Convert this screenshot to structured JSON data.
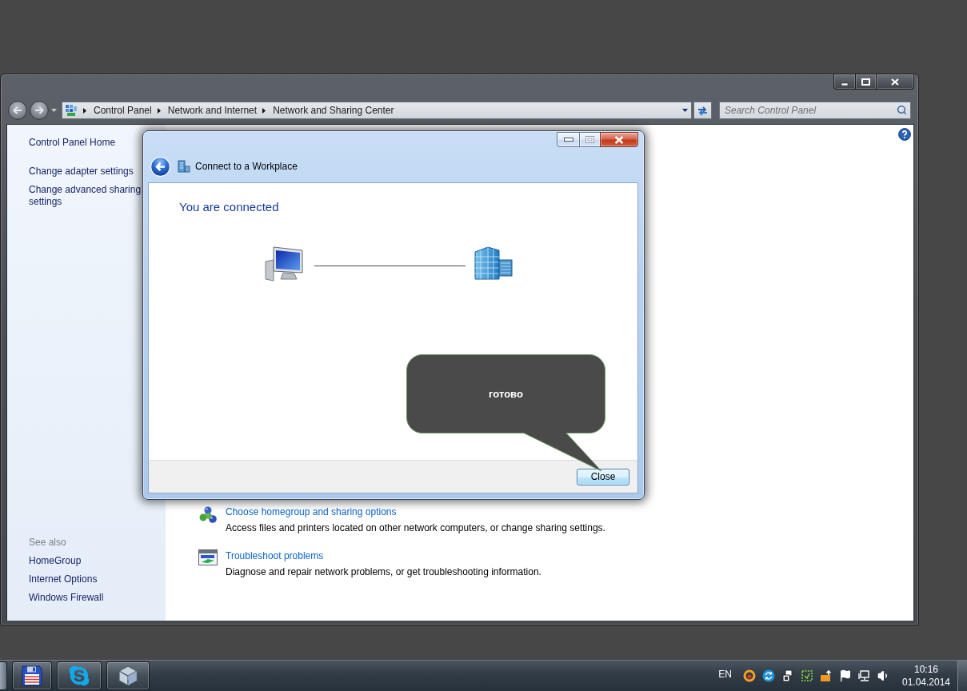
{
  "window": {
    "breadcrumb": [
      "Control Panel",
      "Network and Internet",
      "Network and Sharing Center"
    ],
    "search": {
      "placeholder": "Search Control Panel"
    }
  },
  "sidebar": {
    "home": "Control Panel Home",
    "tasks": [
      "Change adapter settings",
      "Change advanced sharing settings"
    ],
    "see_also": {
      "heading": "See also",
      "items": [
        "HomeGroup",
        "Internet Options",
        "Windows Firewall"
      ]
    }
  },
  "tasks": [
    {
      "kind": "homegroup",
      "title": "Choose homegroup and sharing options",
      "description": "Access files and printers located on other network computers, or change sharing settings."
    },
    {
      "kind": "troubleshoot",
      "title": "Troubleshoot problems",
      "description": "Diagnose and repair network problems, or get troubleshooting information."
    }
  ],
  "dialog": {
    "title": "Connect to a Workplace",
    "heading": "You are connected",
    "buttons": [
      "Close"
    ]
  },
  "callout": {
    "text": "готово"
  },
  "taskbar": {
    "language": "EN",
    "time": "10:16",
    "date": "01.04.2014"
  }
}
